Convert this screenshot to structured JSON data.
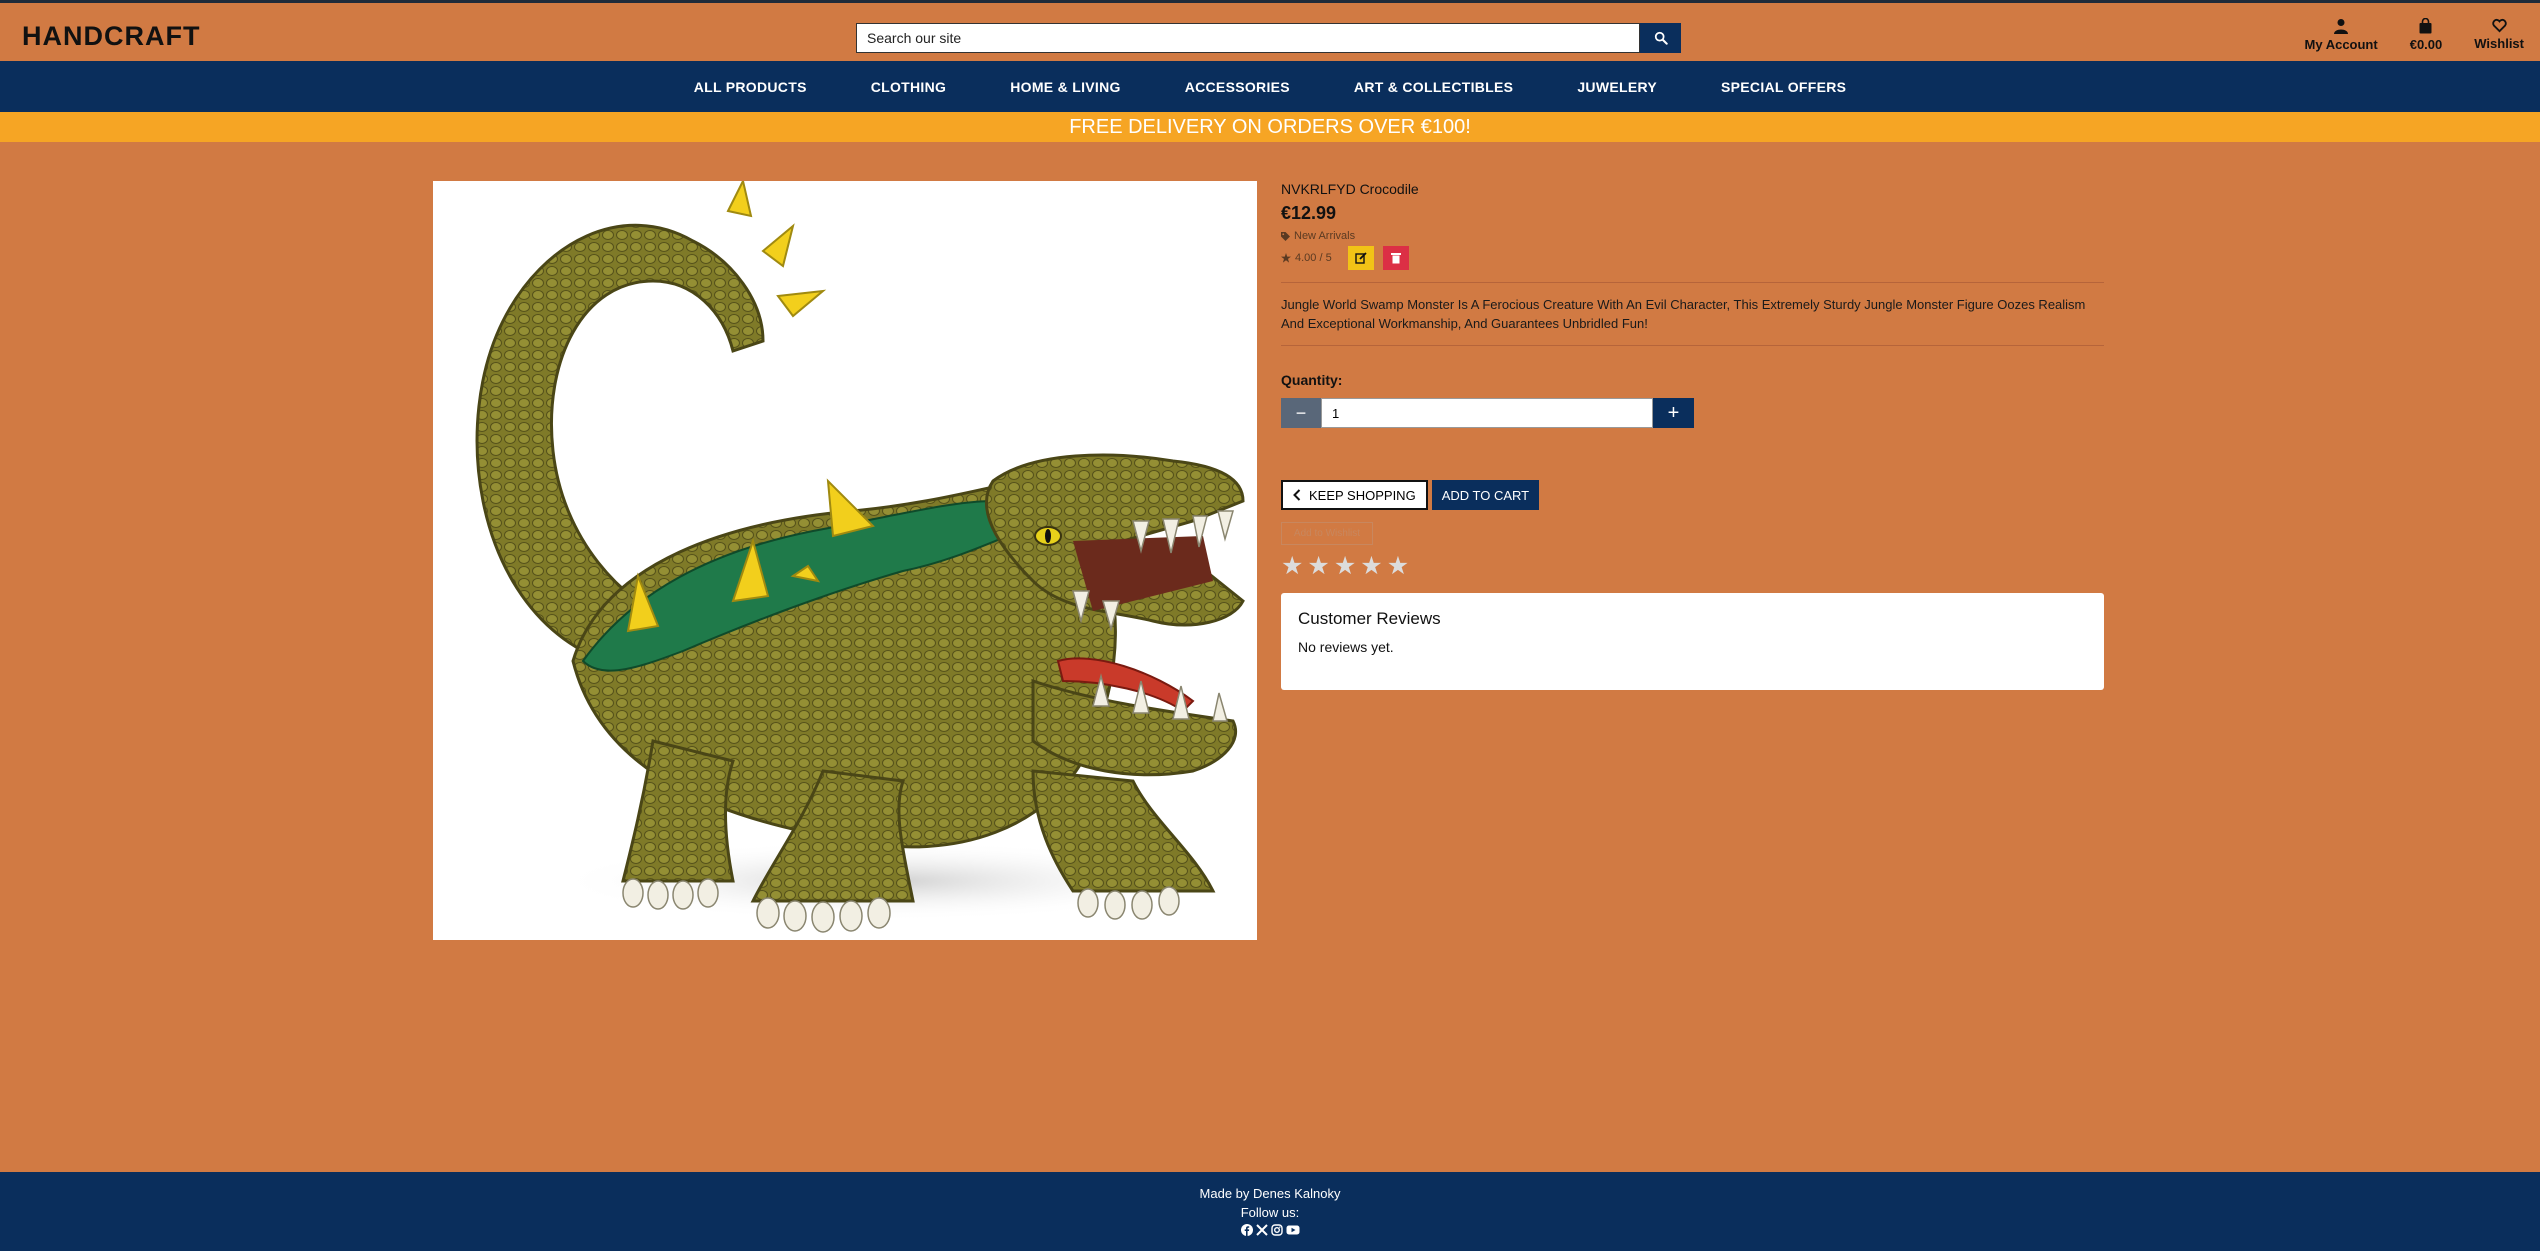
{
  "header": {
    "logo": "HANDCRAFT",
    "search_placeholder": "Search our site",
    "actions": {
      "account": "My Account",
      "cart": "€0.00",
      "wishlist": "Wishlist"
    }
  },
  "nav": {
    "items": [
      "ALL PRODUCTS",
      "CLOTHING",
      "HOME & LIVING",
      "ACCESSORIES",
      "ART & COLLECTIBLES",
      "JUWELERY",
      "SPECIAL OFFERS"
    ]
  },
  "promo": "FREE DELIVERY ON ORDERS OVER €100!",
  "product": {
    "title": "NVKRLFYD Crocodile",
    "price": "€12.99",
    "category": "New Arrivals",
    "rating": "4.00 / 5",
    "description": "Jungle World Swamp Monster Is A Ferocious Creature With An Evil Character, This Extremely Sturdy Jungle Monster Figure Oozes Realism And Exceptional Workmanship, And Guarantees Unbridled Fun!",
    "quantity_label": "Quantity:",
    "quantity_value": "1",
    "keep_shopping": "KEEP SHOPPING",
    "add_to_cart": "ADD TO CART",
    "add_to_wishlist": "Add to Wishlist",
    "user_rating_stars": 0
  },
  "reviews": {
    "title": "Customer Reviews",
    "empty": "No reviews yet."
  },
  "footer": {
    "made_by": "Made by Denes Kalnoky",
    "follow": "Follow us:",
    "socials": [
      "facebook-icon",
      "x-icon",
      "instagram-icon",
      "youtube-icon"
    ]
  },
  "colors": {
    "background": "#d17a43",
    "navy": "#0a2e5c",
    "promo": "#f6a524",
    "edit": "#f2c316",
    "delete": "#dc2f45"
  }
}
